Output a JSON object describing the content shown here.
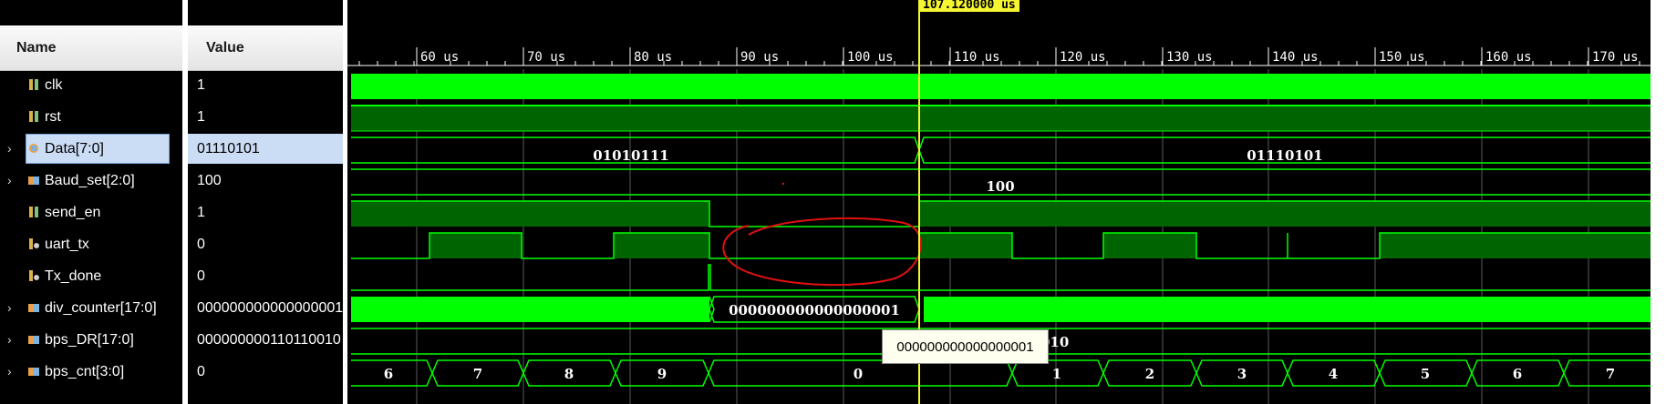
{
  "header": {
    "name_label": "Name",
    "value_label": "Value"
  },
  "cursor": {
    "label": "107.120000 us"
  },
  "signals": [
    {
      "name": "clk",
      "value": "1",
      "icon": "bit-signal-icon",
      "expandable": false
    },
    {
      "name": "rst",
      "value": "1",
      "icon": "bit-signal-icon",
      "expandable": false
    },
    {
      "name": "Data[7:0]",
      "value": "01110101",
      "icon": "bus-input-icon",
      "expandable": true,
      "selected": true
    },
    {
      "name": "Baud_set[2:0]",
      "value": "100",
      "icon": "bus-icon",
      "expandable": true
    },
    {
      "name": "send_en",
      "value": "1",
      "icon": "bit-signal-icon",
      "expandable": false
    },
    {
      "name": "uart_tx",
      "value": "0",
      "icon": "bit-output-icon",
      "expandable": false
    },
    {
      "name": "Tx_done",
      "value": "0",
      "icon": "bit-output-icon",
      "expandable": false
    },
    {
      "name": "div_counter[17:0]",
      "value": "000000000000000001",
      "icon": "bus-icon",
      "expandable": true
    },
    {
      "name": "bps_DR[17:0]",
      "value": "000000000110110010",
      "icon": "bus-icon",
      "expandable": true
    },
    {
      "name": "bps_cnt[3:0]",
      "value": "0",
      "icon": "bus-icon",
      "expandable": true
    }
  ],
  "timeline": {
    "ticks": [
      "60 us",
      "70 us",
      "80 us",
      "90 us",
      "100 us",
      "110 us",
      "120 us",
      "130 us",
      "140 us",
      "150 us",
      "160 us",
      "170 us"
    ]
  },
  "wave_labels": {
    "data_before": "01010111",
    "data_after": "01110101",
    "baud": "100",
    "div_counter_mid": "000000000000000001",
    "bps_dr_partial": "010",
    "bps_cnt": [
      "6",
      "7",
      "8",
      "9",
      "0",
      "1",
      "2",
      "3",
      "4",
      "5",
      "6",
      "7"
    ]
  },
  "tooltip": {
    "text": "000000000000000001"
  },
  "colors": {
    "wave_green": "#00ff00",
    "wave_dark": "#006400",
    "cursor": "#f5f531",
    "annotation": "#e01010"
  }
}
